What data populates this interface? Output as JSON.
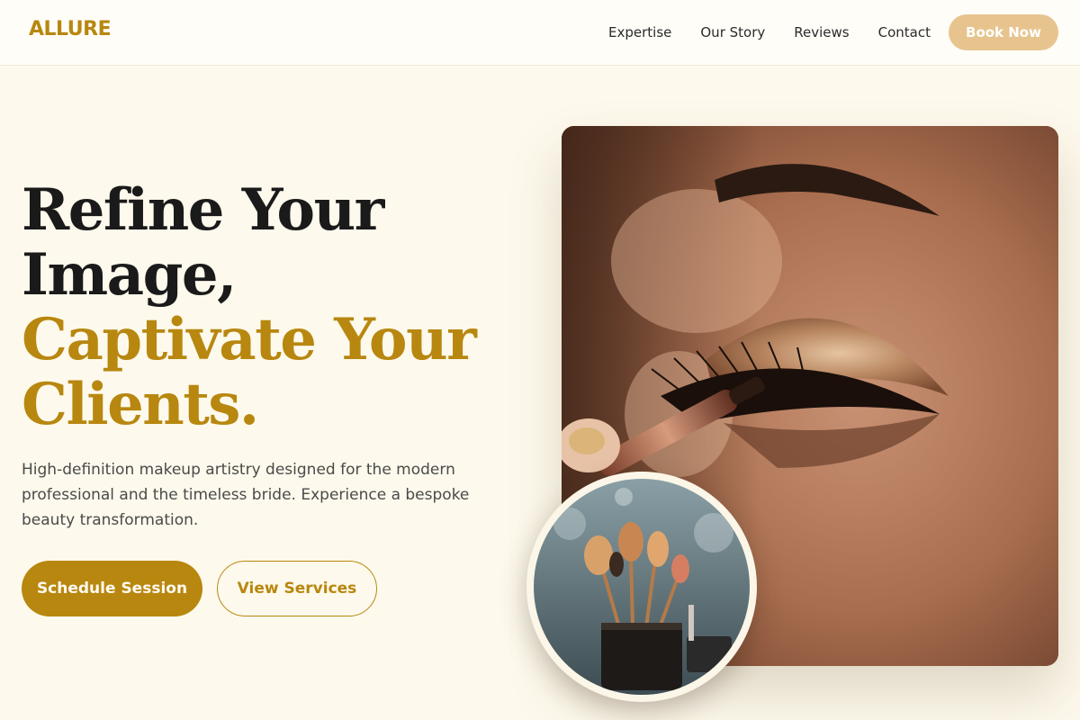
{
  "brand": {
    "name": "ALLURE",
    "color": "#b8870f"
  },
  "nav": {
    "items": [
      "Expertise",
      "Our Story",
      "Reviews",
      "Contact"
    ],
    "cta": "Book Now"
  },
  "hero": {
    "headline_line1": "Refine Your",
    "headline_line2": "Image,",
    "headline_line3": "Captivate Your",
    "headline_line4": "Clients.",
    "subtitle": "High-definition makeup artistry designed for the modern professional and the timeless bride. Experience a bespoke beauty transformation.",
    "primary_button": "Schedule Session",
    "secondary_button": "View Services"
  },
  "images": {
    "main": {
      "subject": "eye-makeup-closeup-photo"
    },
    "inset": {
      "subject": "makeup-brushes-cup-photo"
    }
  },
  "colors": {
    "accent": "#b8870f",
    "book_button": "#e7c48e",
    "background": "#fdf9ec"
  }
}
